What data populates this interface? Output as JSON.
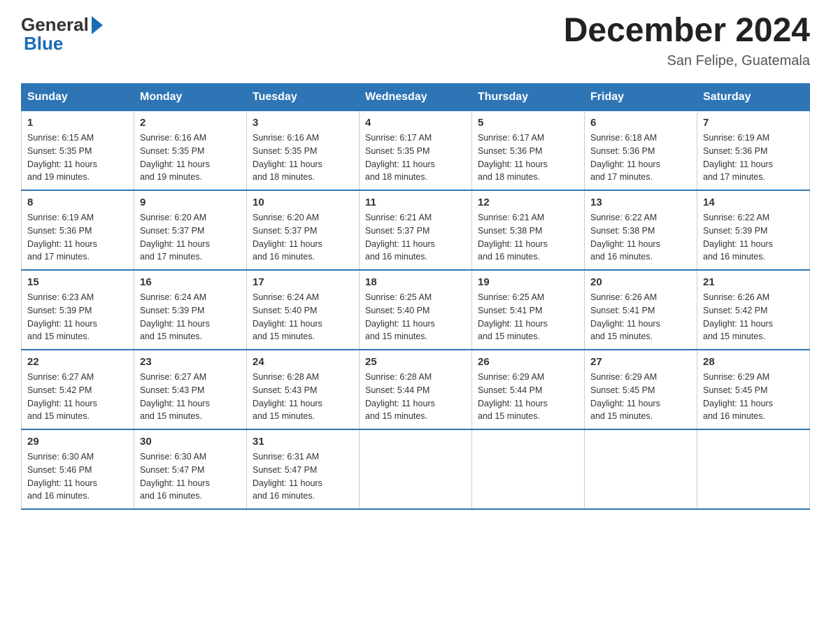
{
  "header": {
    "logo_line1": "General",
    "logo_line2": "Blue",
    "month_year": "December 2024",
    "location": "San Felipe, Guatemala"
  },
  "days_of_week": [
    "Sunday",
    "Monday",
    "Tuesday",
    "Wednesday",
    "Thursday",
    "Friday",
    "Saturday"
  ],
  "weeks": [
    [
      {
        "day": "1",
        "sunrise": "6:15 AM",
        "sunset": "5:35 PM",
        "daylight": "11 hours and 19 minutes."
      },
      {
        "day": "2",
        "sunrise": "6:16 AM",
        "sunset": "5:35 PM",
        "daylight": "11 hours and 19 minutes."
      },
      {
        "day": "3",
        "sunrise": "6:16 AM",
        "sunset": "5:35 PM",
        "daylight": "11 hours and 18 minutes."
      },
      {
        "day": "4",
        "sunrise": "6:17 AM",
        "sunset": "5:35 PM",
        "daylight": "11 hours and 18 minutes."
      },
      {
        "day": "5",
        "sunrise": "6:17 AM",
        "sunset": "5:36 PM",
        "daylight": "11 hours and 18 minutes."
      },
      {
        "day": "6",
        "sunrise": "6:18 AM",
        "sunset": "5:36 PM",
        "daylight": "11 hours and 17 minutes."
      },
      {
        "day": "7",
        "sunrise": "6:19 AM",
        "sunset": "5:36 PM",
        "daylight": "11 hours and 17 minutes."
      }
    ],
    [
      {
        "day": "8",
        "sunrise": "6:19 AM",
        "sunset": "5:36 PM",
        "daylight": "11 hours and 17 minutes."
      },
      {
        "day": "9",
        "sunrise": "6:20 AM",
        "sunset": "5:37 PM",
        "daylight": "11 hours and 17 minutes."
      },
      {
        "day": "10",
        "sunrise": "6:20 AM",
        "sunset": "5:37 PM",
        "daylight": "11 hours and 16 minutes."
      },
      {
        "day": "11",
        "sunrise": "6:21 AM",
        "sunset": "5:37 PM",
        "daylight": "11 hours and 16 minutes."
      },
      {
        "day": "12",
        "sunrise": "6:21 AM",
        "sunset": "5:38 PM",
        "daylight": "11 hours and 16 minutes."
      },
      {
        "day": "13",
        "sunrise": "6:22 AM",
        "sunset": "5:38 PM",
        "daylight": "11 hours and 16 minutes."
      },
      {
        "day": "14",
        "sunrise": "6:22 AM",
        "sunset": "5:39 PM",
        "daylight": "11 hours and 16 minutes."
      }
    ],
    [
      {
        "day": "15",
        "sunrise": "6:23 AM",
        "sunset": "5:39 PM",
        "daylight": "11 hours and 15 minutes."
      },
      {
        "day": "16",
        "sunrise": "6:24 AM",
        "sunset": "5:39 PM",
        "daylight": "11 hours and 15 minutes."
      },
      {
        "day": "17",
        "sunrise": "6:24 AM",
        "sunset": "5:40 PM",
        "daylight": "11 hours and 15 minutes."
      },
      {
        "day": "18",
        "sunrise": "6:25 AM",
        "sunset": "5:40 PM",
        "daylight": "11 hours and 15 minutes."
      },
      {
        "day": "19",
        "sunrise": "6:25 AM",
        "sunset": "5:41 PM",
        "daylight": "11 hours and 15 minutes."
      },
      {
        "day": "20",
        "sunrise": "6:26 AM",
        "sunset": "5:41 PM",
        "daylight": "11 hours and 15 minutes."
      },
      {
        "day": "21",
        "sunrise": "6:26 AM",
        "sunset": "5:42 PM",
        "daylight": "11 hours and 15 minutes."
      }
    ],
    [
      {
        "day": "22",
        "sunrise": "6:27 AM",
        "sunset": "5:42 PM",
        "daylight": "11 hours and 15 minutes."
      },
      {
        "day": "23",
        "sunrise": "6:27 AM",
        "sunset": "5:43 PM",
        "daylight": "11 hours and 15 minutes."
      },
      {
        "day": "24",
        "sunrise": "6:28 AM",
        "sunset": "5:43 PM",
        "daylight": "11 hours and 15 minutes."
      },
      {
        "day": "25",
        "sunrise": "6:28 AM",
        "sunset": "5:44 PM",
        "daylight": "11 hours and 15 minutes."
      },
      {
        "day": "26",
        "sunrise": "6:29 AM",
        "sunset": "5:44 PM",
        "daylight": "11 hours and 15 minutes."
      },
      {
        "day": "27",
        "sunrise": "6:29 AM",
        "sunset": "5:45 PM",
        "daylight": "11 hours and 15 minutes."
      },
      {
        "day": "28",
        "sunrise": "6:29 AM",
        "sunset": "5:45 PM",
        "daylight": "11 hours and 16 minutes."
      }
    ],
    [
      {
        "day": "29",
        "sunrise": "6:30 AM",
        "sunset": "5:46 PM",
        "daylight": "11 hours and 16 minutes."
      },
      {
        "day": "30",
        "sunrise": "6:30 AM",
        "sunset": "5:47 PM",
        "daylight": "11 hours and 16 minutes."
      },
      {
        "day": "31",
        "sunrise": "6:31 AM",
        "sunset": "5:47 PM",
        "daylight": "11 hours and 16 minutes."
      },
      null,
      null,
      null,
      null
    ]
  ],
  "labels": {
    "sunrise": "Sunrise:",
    "sunset": "Sunset:",
    "daylight": "Daylight:"
  }
}
